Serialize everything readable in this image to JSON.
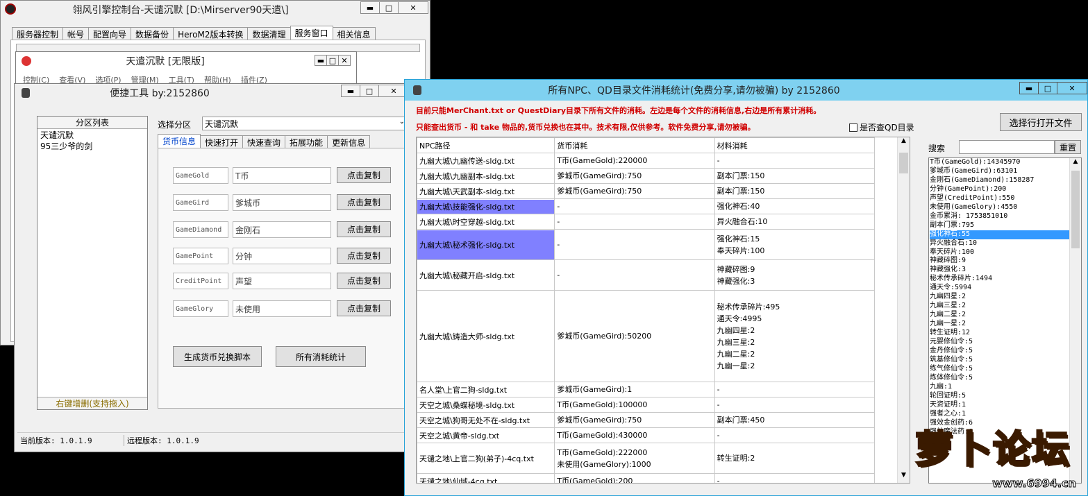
{
  "win_main": {
    "title": "翎风引擎控制台-天谴沉默 [D:\\Mirserver90天遣\\]",
    "tabs": [
      "服务器控制",
      "帐号",
      "配置向导",
      "数据备份",
      "HeroM2版本转换",
      "数据清理",
      "服务窗口",
      "相关信息"
    ]
  },
  "win_inner": {
    "title": "天遣沉默 [无限版]",
    "menu": [
      "控制(C)",
      "查看(V)",
      "选项(P)",
      "管理(M)",
      "工具(T)",
      "帮助(H)",
      "插件(Z)"
    ]
  },
  "win_tool": {
    "title": "便捷工具 by:2152860",
    "partition_header": "分区列表",
    "partitions": [
      "天谴沉默",
      "95三少爷的剑"
    ],
    "partition_footer": "右键增删(支持拖入)",
    "select_label": "选择分区",
    "select_value": "天谴沉默",
    "tabs": [
      "货币信息",
      "快速打开",
      "快速查询",
      "拓展功能",
      "更新信息"
    ],
    "rows": [
      {
        "code": "GameGold",
        "name": "T币",
        "btn": "点击复制"
      },
      {
        "code": "GameGird",
        "name": "爹城币",
        "btn": "点击复制"
      },
      {
        "code": "GameDiamond",
        "name": "金刚石",
        "btn": "点击复制"
      },
      {
        "code": "GamePoint",
        "name": "分钟",
        "btn": "点击复制"
      },
      {
        "code": "CreditPoint",
        "name": "声望",
        "btn": "点击复制"
      },
      {
        "code": "GameGlory",
        "name": "未使用",
        "btn": "点击复制"
      }
    ],
    "btn_gen": "生成货币兑换脚本",
    "btn_stats": "所有消耗统计",
    "status_local": "当前版本: 1.0.1.9",
    "status_remote": "远程版本: 1.0.1.9"
  },
  "win_stats": {
    "title": "所有NPC、QD目录文件消耗统计(免费分享,请勿被骗)   by 2152860",
    "note1": "目前只能MerChant.txt or QuestDiary目录下所有文件的消耗。左边是每个文件的消耗信息,右边是所有累计消耗。",
    "note2": "只能查出货币 - 和 take 物品的,货币兑换也在其中。技术有限,仅供参考。软件免费分享,请勿被骗。",
    "checkbox_label": "是否查QD目录",
    "btn_open": "选择行打开文件",
    "search_label": "搜索",
    "btn_reset": "重置",
    "columns": [
      "NPC路径",
      "货币消耗",
      "材料消耗"
    ],
    "rows": [
      {
        "path": "九幽大城\\九幽传送-sldg.txt",
        "cur": [
          "T币(GameGold):220000"
        ],
        "mat": [
          "-"
        ],
        "h": 22
      },
      {
        "path": "九幽大城\\九幽副本-sldg.txt",
        "cur": [
          "爹城币(GameGird):750"
        ],
        "mat": [
          "副本门票:150"
        ],
        "h": 22
      },
      {
        "path": "九幽大城\\天武副本-sldg.txt",
        "cur": [
          "爹城币(GameGird):750"
        ],
        "mat": [
          "副本门票:150"
        ],
        "h": 22
      },
      {
        "path": "九幽大城\\技能强化-sldg.txt",
        "cur": [
          "-"
        ],
        "mat": [
          "强化神石:40"
        ],
        "h": 22,
        "sel": true
      },
      {
        "path": "九幽大城\\时空穿越-sldg.txt",
        "cur": [
          "-"
        ],
        "mat": [
          "异火融合石:10"
        ],
        "h": 22
      },
      {
        "path": "九幽大城\\秘术强化-sldg.txt",
        "cur": [
          "-"
        ],
        "mat": [
          "强化神石:15",
          "奉天碎片:100"
        ],
        "h": 44,
        "sel": true
      },
      {
        "path": "九幽大城\\秘藏开启-sldg.txt",
        "cur": [
          "-"
        ],
        "mat": [
          "神藏碎图:9",
          "神藏强化:3"
        ],
        "h": 44
      },
      {
        "path": "九幽大城\\铸造大师-sldg.txt",
        "cur": [
          "爹城币(GameGird):50200"
        ],
        "mat": [
          "秘术传承碎片:495",
          "通天令:4995",
          "九幽四星:2",
          "九幽三星:2",
          "九幽二星:2",
          "九幽一星:2"
        ],
        "h": 132
      },
      {
        "path": "名人堂\\上官二狗-sldg.txt",
        "cur": [
          "爹城币(GameGird):1"
        ],
        "mat": [
          "-"
        ],
        "h": 22
      },
      {
        "path": "天空之城\\桑蝶秘境-sldg.txt",
        "cur": [
          "T币(GameGold):100000"
        ],
        "mat": [
          "-"
        ],
        "h": 22
      },
      {
        "path": "天空之城\\狗哥无处不在-sldg.txt",
        "cur": [
          "爹城币(GameGird):750"
        ],
        "mat": [
          "副本门票:450"
        ],
        "h": 22
      },
      {
        "path": "天空之城\\黄帝-sldg.txt",
        "cur": [
          "T币(GameGold):430000"
        ],
        "mat": [
          "-"
        ],
        "h": 22
      },
      {
        "path": "天谴之地\\上官二狗(弟子)-4cq.txt",
        "cur": [
          "T币(GameGold):222000",
          "未使用(GameGlory):1000"
        ],
        "mat": [
          "转生证明:2"
        ],
        "h": 44
      },
      {
        "path": "天谴之地\\仙域-4cq.txt",
        "cur": [
          "T币(GameGold):200"
        ],
        "mat": [
          "-"
        ],
        "h": 22
      }
    ],
    "totals": [
      "T币(GameGold):14345970",
      "爹城币(GameGird):63101",
      "金刚石(GameDiamond):158287",
      "分钟(GamePoint):200",
      "声望(CreditPoint):550",
      "未使用(GameGlory):4550",
      "金币累消: 1753851010",
      "副本门票:795",
      "强化神石:55",
      "异火融合石:10",
      "奉天碎片:100",
      "神藏碎图:9",
      "神藏强化:3",
      "秘术传承碎片:1494",
      "通天令:5994",
      "九幽四星:2",
      "九幽三星:2",
      "九幽二星:2",
      "九幽一星:2",
      "转生证明:12",
      "元婴修仙令:5",
      "金丹修仙令:5",
      "筑基修仙令:5",
      "练气修仙令:5",
      "炼体修仙令:5",
      "九幽:1",
      "轮回证明:5",
      "天资证明:1",
      "强者之心:1",
      "强效金创药:6",
      "强效魔法药:6"
    ],
    "selected_total_index": 8
  },
  "watermark": {
    "text": "萝卜论坛",
    "url": "www.6994.cn"
  }
}
